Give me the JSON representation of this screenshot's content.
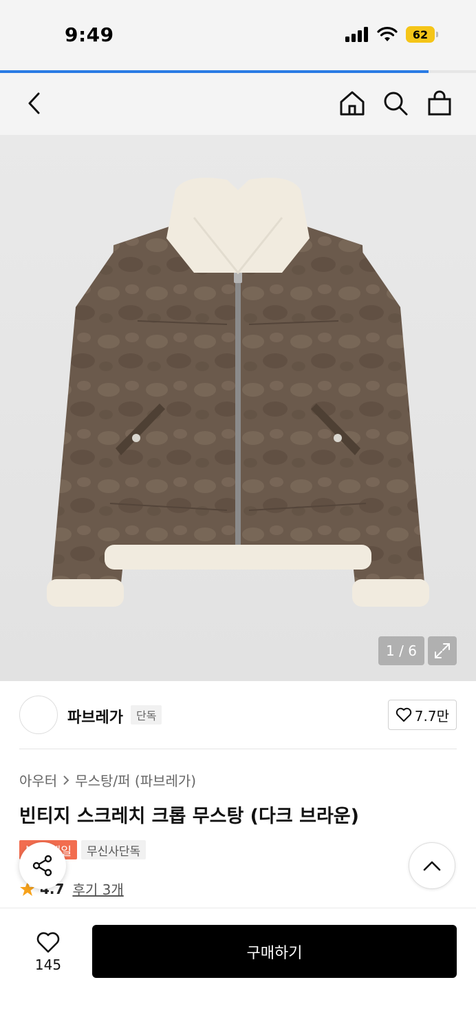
{
  "status_bar": {
    "time": "9:49",
    "battery": "62"
  },
  "page_load": {
    "progress": 0.9
  },
  "nav": {
    "back_icon": "chevron-left-icon",
    "home_icon": "home-icon",
    "search_icon": "search-icon",
    "cart_icon": "shopping-bag-icon"
  },
  "gallery": {
    "counter": "1 / 6"
  },
  "brand": {
    "name": "파브레가",
    "tag": "단독",
    "likes": "7.7만"
  },
  "product": {
    "breadcrumb": [
      "아우터",
      "무스탕/퍼 (파브레가)"
    ],
    "title": "빈티지 스크레치 크롭 무스탕 (다크 브라운)",
    "badge_sale": "블프 세일",
    "badge_exclusive": "무신사단독",
    "rating": "4.7",
    "reviews": "후기 3개"
  },
  "bottom_bar": {
    "wish_count": "145",
    "buy_label": "구매하기"
  },
  "colors": {
    "accent_blue": "#2a7be4",
    "sale_orange": "#f26d4f",
    "star": "#f7a21b",
    "buy_bg": "#000000"
  }
}
